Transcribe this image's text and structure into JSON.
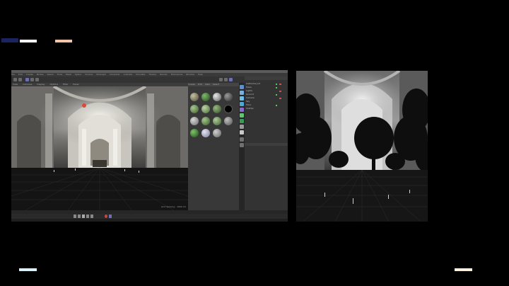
{
  "colors": {
    "background": "#000000",
    "bar_top_navy": "#1a2560",
    "bar_top_white": "#ffffff",
    "bar_top_peach": "#f2c4a8",
    "bar_bottom_left": "#d8f2f8",
    "bar_bottom_right": "#faf0dc",
    "accent_blue": "#6d6fb5"
  },
  "c4d": {
    "menu_items": [
      "File",
      "Edit",
      "Create",
      "Modes",
      "Select",
      "Tools",
      "Mesh",
      "Spline",
      "Volume",
      "MoGraph",
      "Character",
      "Animate",
      "Simulate",
      "Tracker",
      "Render",
      "Extensions",
      "Window",
      "Help"
    ],
    "viewport_menu": [
      "View",
      "Cameras",
      "Display",
      "Options",
      "Filter",
      "Panel"
    ],
    "material_menu": [
      "Create",
      "Edit",
      "View",
      "Select",
      "Material",
      "Texture"
    ],
    "objects": [
      {
        "name": "Cathedral_Int",
        "state": "on"
      },
      {
        "name": "Trees",
        "state": "on"
      },
      {
        "name": "Lights",
        "state": "on"
      },
      {
        "name": "Ground",
        "state": "on"
      },
      {
        "name": "Camera",
        "state": "on"
      },
      {
        "name": "Sky",
        "state": "off"
      },
      {
        "name": "Floor",
        "state": "on"
      },
      {
        "name": "Scatter",
        "state": "on"
      }
    ],
    "viewport_status": "Grid Spacing : 1000 cm"
  },
  "icons": [
    "play-icon",
    "record-icon",
    "move-icon",
    "rotate-icon",
    "scale-icon",
    "render-icon"
  ]
}
